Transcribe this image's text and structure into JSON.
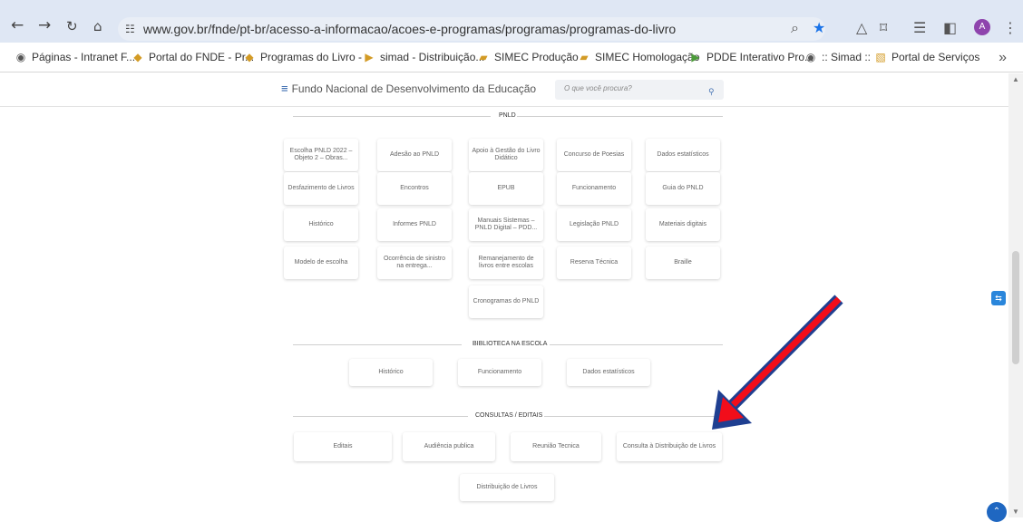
{
  "browser": {
    "url": "www.gov.br/fnde/pt-br/acesso-a-informacao/acoes-e-programas/programas/programas-do-livro",
    "avatar": "A"
  },
  "bookmarks": [
    "Páginas - Intranet F...",
    "Portal do FNDE - Pr...",
    "Programas do Livro -",
    "simad - Distribuição...",
    "SIMEC Produção",
    "SIMEC Homologação",
    "PDDE Interativo Pro...",
    ":: Simad ::",
    "Portal de Serviços"
  ],
  "header": {
    "site_title": "Fundo Nacional de Desenvolvimento da Educação",
    "search_placeholder": "O que você procura?"
  },
  "sections": {
    "pnld": {
      "title": "PNLD",
      "items": [
        "Escolha PNLD 2022 – Objeto 2 – Obras...",
        "Adesão ao PNLD",
        "Apoio à Gestão do Livro Didático",
        "Concurso de Poesias",
        "Dados estatísticos",
        "Desfazimento de Livros",
        "Encontros",
        "EPUB",
        "Funcionamento",
        "Guia do PNLD",
        "Histórico",
        "Informes PNLD",
        "Manuais Sistemas – PNLD Digital – PDD...",
        "Legislação PNLD",
        "Materiais digitais",
        "Modelo de escolha",
        "Ocorrência de sinistro na entrega...",
        "Remanejamento de livros entre escolas",
        "Reserva Técnica",
        "Braille",
        "Cronogramas do PNLD"
      ]
    },
    "biblioteca": {
      "title": "BIBLIOTECA NA ESCOLA",
      "items": [
        "Histórico",
        "Funcionamento",
        "Dados estatísticos"
      ]
    },
    "consultas": {
      "title": "CONSULTAS / EDITAIS",
      "items": [
        "Editais",
        "Audiência publica",
        "Reunião Tecnica",
        "Consulta à Distribuição de Livros",
        "Distribuição de Livros"
      ]
    }
  }
}
